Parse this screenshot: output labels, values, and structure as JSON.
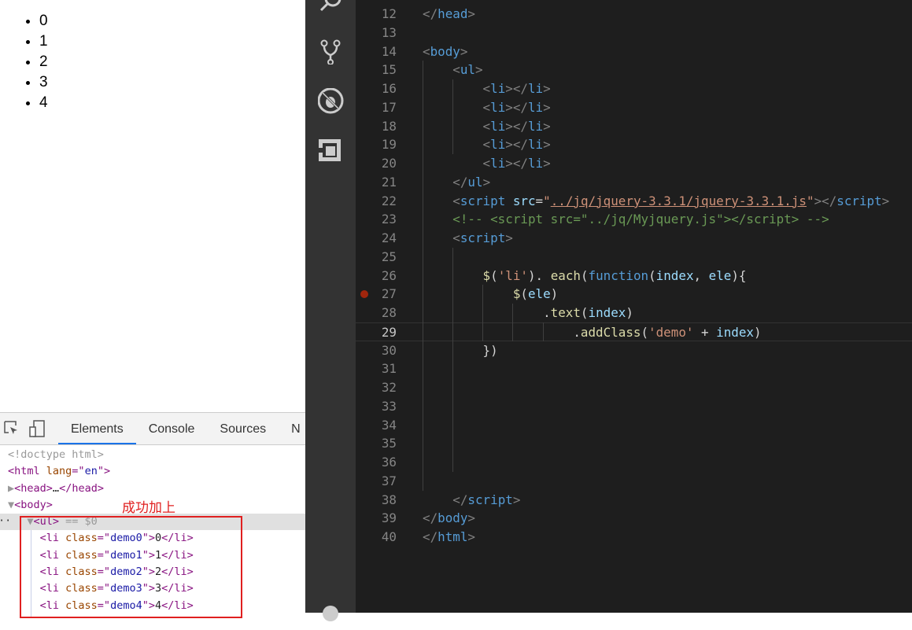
{
  "page": {
    "items": [
      "0",
      "1",
      "2",
      "3",
      "4"
    ]
  },
  "devtools": {
    "tabs": [
      "Elements",
      "Console",
      "Sources",
      "N"
    ],
    "active_tab": "Elements",
    "annotation": "成功加上",
    "tree": [
      [
        [
          "gr",
          "<!doctype html>"
        ]
      ],
      [
        [
          "tg",
          "<html "
        ],
        [
          "at",
          "lang"
        ],
        [
          "tg",
          "=\""
        ],
        [
          "av",
          "en"
        ],
        [
          "tg",
          "\">"
        ]
      ],
      [
        [
          "gr",
          "▶"
        ],
        [
          "tg",
          "<head>"
        ],
        [
          "tx",
          "…"
        ],
        [
          "tg",
          "</head>"
        ]
      ],
      [
        [
          "gr",
          "▼"
        ],
        [
          "tg",
          "<body>"
        ]
      ],
      [
        [
          "gr",
          "   ▼"
        ],
        [
          "tg",
          "<ul>"
        ],
        [
          "gr",
          " == $0"
        ]
      ],
      [
        [
          "tx",
          "     "
        ],
        [
          "tg",
          "<li "
        ],
        [
          "at",
          "class"
        ],
        [
          "tg",
          "=\""
        ],
        [
          "av",
          "demo0"
        ],
        [
          "tg",
          "\">"
        ],
        [
          "tx",
          "0"
        ],
        [
          "tg",
          "</li>"
        ]
      ],
      [
        [
          "tx",
          "     "
        ],
        [
          "tg",
          "<li "
        ],
        [
          "at",
          "class"
        ],
        [
          "tg",
          "=\""
        ],
        [
          "av",
          "demo1"
        ],
        [
          "tg",
          "\">"
        ],
        [
          "tx",
          "1"
        ],
        [
          "tg",
          "</li>"
        ]
      ],
      [
        [
          "tx",
          "     "
        ],
        [
          "tg",
          "<li "
        ],
        [
          "at",
          "class"
        ],
        [
          "tg",
          "=\""
        ],
        [
          "av",
          "demo2"
        ],
        [
          "tg",
          "\">"
        ],
        [
          "tx",
          "2"
        ],
        [
          "tg",
          "</li>"
        ]
      ],
      [
        [
          "tx",
          "     "
        ],
        [
          "tg",
          "<li "
        ],
        [
          "at",
          "class"
        ],
        [
          "tg",
          "=\""
        ],
        [
          "av",
          "demo3"
        ],
        [
          "tg",
          "\">"
        ],
        [
          "tx",
          "3"
        ],
        [
          "tg",
          "</li>"
        ]
      ],
      [
        [
          "tx",
          "     "
        ],
        [
          "tg",
          "<li "
        ],
        [
          "at",
          "class"
        ],
        [
          "tg",
          "=\""
        ],
        [
          "av",
          "demo4"
        ],
        [
          "tg",
          "\">"
        ],
        [
          "tx",
          "4"
        ],
        [
          "tg",
          "</li>"
        ]
      ]
    ]
  },
  "activity_bar": [
    "search-icon",
    "source-control-icon",
    "debug-icon",
    "extensions-icon",
    "settings-icon"
  ],
  "editor": {
    "current_line": 29,
    "breakpoint_line": 27,
    "lines": [
      {
        "n": 12,
        "t": [
          [
            "p",
            "</"
          ],
          [
            "t",
            "head"
          ],
          [
            "p",
            ">"
          ]
        ]
      },
      {
        "n": 13,
        "t": []
      },
      {
        "n": 14,
        "t": [
          [
            "p",
            "<"
          ],
          [
            "t",
            "body"
          ],
          [
            "p",
            ">"
          ]
        ]
      },
      {
        "n": 15,
        "t": [
          [
            "d",
            "    "
          ],
          [
            "p",
            "<"
          ],
          [
            "t",
            "ul"
          ],
          [
            "p",
            ">"
          ]
        ]
      },
      {
        "n": 16,
        "t": [
          [
            "d",
            "        "
          ],
          [
            "p",
            "<"
          ],
          [
            "t",
            "li"
          ],
          [
            "p",
            "></"
          ],
          [
            "t",
            "li"
          ],
          [
            "p",
            ">"
          ]
        ]
      },
      {
        "n": 17,
        "t": [
          [
            "d",
            "        "
          ],
          [
            "p",
            "<"
          ],
          [
            "t",
            "li"
          ],
          [
            "p",
            "></"
          ],
          [
            "t",
            "li"
          ],
          [
            "p",
            ">"
          ]
        ]
      },
      {
        "n": 18,
        "t": [
          [
            "d",
            "        "
          ],
          [
            "p",
            "<"
          ],
          [
            "t",
            "li"
          ],
          [
            "p",
            "></"
          ],
          [
            "t",
            "li"
          ],
          [
            "p",
            ">"
          ]
        ]
      },
      {
        "n": 19,
        "t": [
          [
            "d",
            "        "
          ],
          [
            "p",
            "<"
          ],
          [
            "t",
            "li"
          ],
          [
            "p",
            "></"
          ],
          [
            "t",
            "li"
          ],
          [
            "p",
            ">"
          ]
        ]
      },
      {
        "n": 20,
        "t": [
          [
            "d",
            "        "
          ],
          [
            "p",
            "<"
          ],
          [
            "t",
            "li"
          ],
          [
            "p",
            "></"
          ],
          [
            "t",
            "li"
          ],
          [
            "p",
            ">"
          ]
        ]
      },
      {
        "n": 21,
        "t": [
          [
            "d",
            "    "
          ],
          [
            "p",
            "</"
          ],
          [
            "t",
            "ul"
          ],
          [
            "p",
            ">"
          ]
        ]
      },
      {
        "n": 22,
        "t": [
          [
            "d",
            "    "
          ],
          [
            "p",
            "<"
          ],
          [
            "t",
            "script"
          ],
          [
            "d",
            " "
          ],
          [
            "a",
            "src"
          ],
          [
            "d",
            "="
          ],
          [
            "s",
            "\""
          ],
          [
            "su",
            "../jq/jquery-3.3.1/jquery-3.3.1.js"
          ],
          [
            "s",
            "\""
          ],
          [
            "p",
            "></"
          ],
          [
            "t",
            "script"
          ],
          [
            "p",
            ">"
          ]
        ]
      },
      {
        "n": 23,
        "t": [
          [
            "d",
            "    "
          ],
          [
            "c",
            "<!-- <script src=\"../jq/Myjquery.js\"></script> -->"
          ]
        ]
      },
      {
        "n": 24,
        "t": [
          [
            "d",
            "    "
          ],
          [
            "p",
            "<"
          ],
          [
            "t",
            "script"
          ],
          [
            "p",
            ">"
          ]
        ]
      },
      {
        "n": 25,
        "t": []
      },
      {
        "n": 26,
        "t": [
          [
            "d",
            "        "
          ],
          [
            "f",
            "$"
          ],
          [
            "d",
            "("
          ],
          [
            "s",
            "'li'"
          ],
          [
            "d",
            "). "
          ],
          [
            "f",
            "each"
          ],
          [
            "d",
            "("
          ],
          [
            "k",
            "function"
          ],
          [
            "d",
            "("
          ],
          [
            "v",
            "index"
          ],
          [
            "d",
            ", "
          ],
          [
            "v",
            "ele"
          ],
          [
            "d",
            "){"
          ]
        ]
      },
      {
        "n": 27,
        "t": [
          [
            "d",
            "            "
          ],
          [
            "f",
            "$"
          ],
          [
            "d",
            "("
          ],
          [
            "v",
            "ele"
          ],
          [
            "d",
            ")"
          ]
        ]
      },
      {
        "n": 28,
        "t": [
          [
            "d",
            "                ."
          ],
          [
            "f",
            "text"
          ],
          [
            "d",
            "("
          ],
          [
            "v",
            "index"
          ],
          [
            "d",
            ")"
          ]
        ]
      },
      {
        "n": 29,
        "t": [
          [
            "d",
            "                    ."
          ],
          [
            "f",
            "addClass"
          ],
          [
            "d",
            "("
          ],
          [
            "s",
            "'demo'"
          ],
          [
            "d",
            " + "
          ],
          [
            "v",
            "index"
          ],
          [
            "d",
            ")"
          ]
        ]
      },
      {
        "n": 30,
        "t": [
          [
            "d",
            "        })"
          ]
        ]
      },
      {
        "n": 31,
        "t": []
      },
      {
        "n": 32,
        "t": []
      },
      {
        "n": 33,
        "t": []
      },
      {
        "n": 34,
        "t": []
      },
      {
        "n": 35,
        "t": []
      },
      {
        "n": 36,
        "t": []
      },
      {
        "n": 37,
        "t": []
      },
      {
        "n": 38,
        "t": [
          [
            "d",
            "    "
          ],
          [
            "p",
            "</"
          ],
          [
            "t",
            "script"
          ],
          [
            "p",
            ">"
          ]
        ]
      },
      {
        "n": 39,
        "t": [
          [
            "p",
            "</"
          ],
          [
            "t",
            "body"
          ],
          [
            "p",
            ">"
          ]
        ]
      },
      {
        "n": 40,
        "t": [
          [
            "p",
            "</"
          ],
          [
            "t",
            "html"
          ],
          [
            "p",
            ">"
          ]
        ]
      }
    ]
  }
}
